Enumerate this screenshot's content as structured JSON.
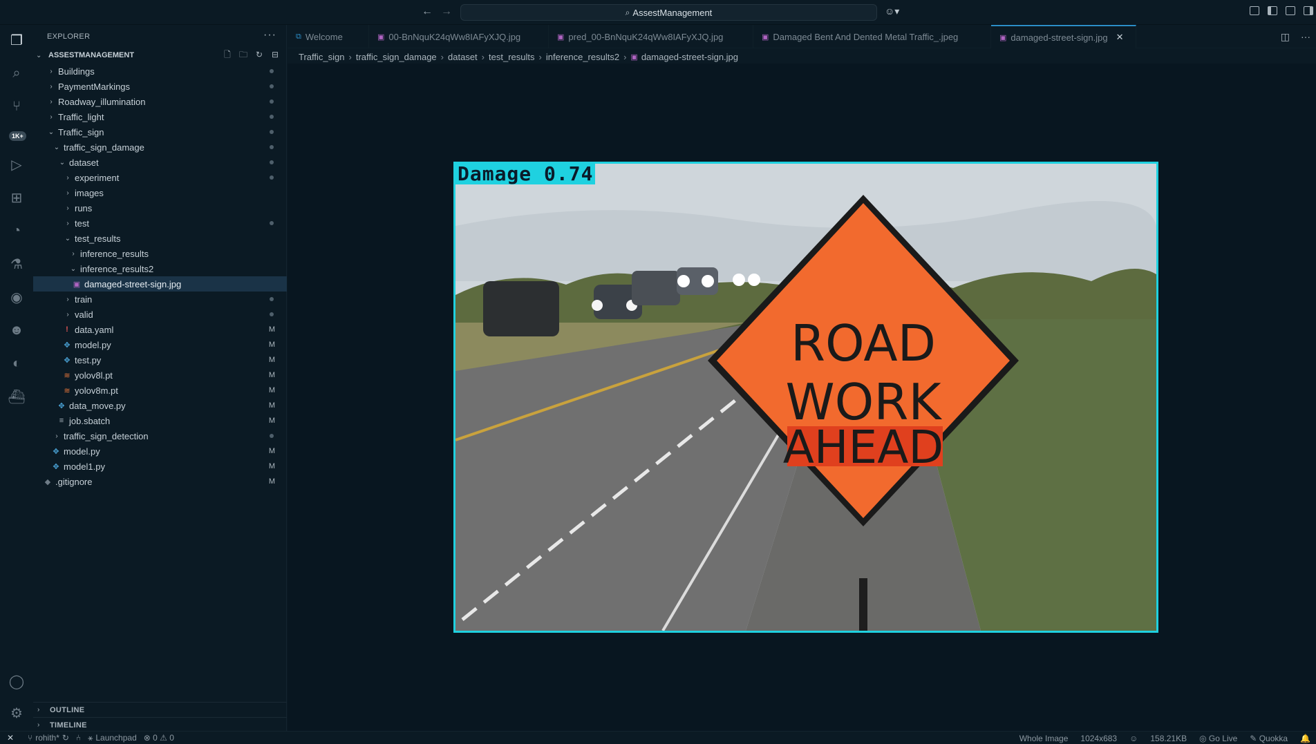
{
  "titlebar": {
    "search_text": "AssestManagement"
  },
  "activity": {
    "badge": "1K+"
  },
  "sidebar": {
    "title": "EXPLORER",
    "root": "ASSESTMANAGEMENT",
    "tree": [
      {
        "label": "Buildings",
        "status": "dot"
      },
      {
        "label": "PaymentMarkings",
        "status": "dot"
      },
      {
        "label": "Roadway_illumination",
        "status": "dot"
      },
      {
        "label": "Traffic_light",
        "status": "dot"
      },
      {
        "label": "Traffic_sign",
        "status": "dot"
      },
      {
        "label": "traffic_sign_damage",
        "status": "dot"
      },
      {
        "label": "dataset",
        "status": "dot"
      },
      {
        "label": "experiment",
        "status": "dot"
      },
      {
        "label": "images",
        "status": ""
      },
      {
        "label": "runs",
        "status": ""
      },
      {
        "label": "test",
        "status": "dot"
      },
      {
        "label": "test_results",
        "status": ""
      },
      {
        "label": "inference_results",
        "status": ""
      },
      {
        "label": "inference_results2",
        "status": ""
      },
      {
        "label": "damaged-street-sign.jpg",
        "status": ""
      },
      {
        "label": "train",
        "status": "dot"
      },
      {
        "label": "valid",
        "status": "dot"
      },
      {
        "label": "data.yaml",
        "status": "M"
      },
      {
        "label": "model.py",
        "status": "M"
      },
      {
        "label": "test.py",
        "status": "M"
      },
      {
        "label": "yolov8l.pt",
        "status": "M"
      },
      {
        "label": "yolov8m.pt",
        "status": "M"
      },
      {
        "label": "data_move.py",
        "status": "M"
      },
      {
        "label": "job.sbatch",
        "status": "M"
      },
      {
        "label": "traffic_sign_detection",
        "status": "dot"
      },
      {
        "label": "model.py",
        "status": "M"
      },
      {
        "label": "model1.py",
        "status": "M"
      },
      {
        "label": ".gitignore",
        "status": "M"
      }
    ],
    "outline": "OUTLINE",
    "timeline": "TIMELINE"
  },
  "tabs": [
    {
      "label": "Welcome"
    },
    {
      "label": "00-BnNquK24qWw8IAFyXJQ.jpg"
    },
    {
      "label": "pred_00-BnNquK24qWw8IAFyXJQ.jpg"
    },
    {
      "label": "Damaged Bent And Dented Metal Traffic_.jpeg"
    },
    {
      "label": "damaged-street-sign.jpg"
    }
  ],
  "breadcrumb": [
    "Traffic_sign",
    "traffic_sign_damage",
    "dataset",
    "test_results",
    "inference_results2",
    "damaged-street-sign.jpg"
  ],
  "image": {
    "detection_label": "Damage  0.74",
    "sign_line1": "ROAD",
    "sign_line2": "WORK",
    "sign_line3": "AHEAD"
  },
  "statusbar": {
    "branch": "rohith*",
    "launchpad": "Launchpad",
    "problems": "⊗ 0 ⚠ 0",
    "whole_image": "Whole Image",
    "dimensions": "1024x683",
    "size": "158.21KB",
    "go_live": "Go Live",
    "quokka": "Quokka"
  },
  "colors": {
    "accent": "#2b8ec7",
    "detection_box": "#1fd1e0",
    "sign_orange": "#f26a2e"
  }
}
